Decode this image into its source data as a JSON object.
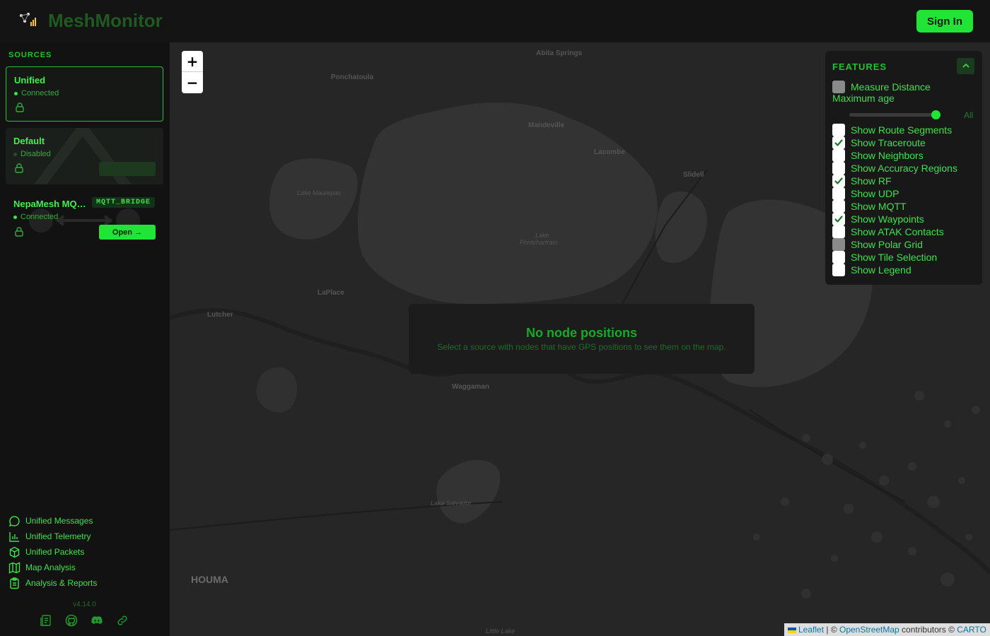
{
  "app": {
    "title": "MeshMonitor",
    "sign_in": "Sign In"
  },
  "sidebar": {
    "sources_title": "SOURCES",
    "sources": [
      {
        "name": "Unified",
        "status": "Connected"
      },
      {
        "name": "Default",
        "status": "Disabled"
      },
      {
        "name": "NepaMesh MQ…",
        "status": "Connected",
        "badge": "MQTT_BRIDGE",
        "action": "Open →"
      }
    ],
    "nav": [
      {
        "label": "Unified Messages",
        "icon": "chat-bubble-icon"
      },
      {
        "label": "Unified Telemetry",
        "icon": "bar-chart-icon"
      },
      {
        "label": "Unified Packets",
        "icon": "package-icon"
      },
      {
        "label": "Map Analysis",
        "icon": "map-icon"
      },
      {
        "label": "Analysis & Reports",
        "icon": "clipboard-icon"
      }
    ],
    "version": "v4.14.0",
    "footer_icons": [
      "docs-icon",
      "github-icon",
      "discord-icon",
      "link-icon"
    ]
  },
  "map": {
    "zoom_in": "+",
    "zoom_out": "−",
    "labels": {
      "abita_springs": "Abita Springs",
      "ponchatoula": "Ponchatoula",
      "mandeville": "Mandeville",
      "lacombe": "Lacombe",
      "slidell": "Slidell",
      "lake_maurepas": "Lake Maurepas",
      "lake_pontchartrain_1": "Lake",
      "lake_pontchartrain_2": "Pontchartrain",
      "laplace": "LaPlace",
      "lutcher": "Lutcher",
      "waggaman": "Waggaman",
      "lake_salvador": "Lake Salvador",
      "houma": "HOUMA",
      "little_lake": "Little Lake"
    },
    "empty_state": {
      "title": "No node positions",
      "subtitle": "Select a source with nodes that have GPS positions to see them on the map."
    },
    "attribution": {
      "leaflet": "Leaflet",
      "sep": " | © ",
      "osm": "OpenStreetMap",
      "contributors": " contributors © ",
      "carto": "CARTO"
    }
  },
  "features": {
    "title": "FEATURES",
    "measure_distance": {
      "label": "Measure Distance",
      "checked": false,
      "disabled": true
    },
    "max_age_label": "Maximum age",
    "max_age_value_label": "All",
    "max_age_fraction": 1.0,
    "options": [
      {
        "label": "Show Route Segments",
        "checked": false,
        "disabled": false
      },
      {
        "label": "Show Traceroute",
        "checked": true,
        "disabled": false
      },
      {
        "label": "Show Neighbors",
        "checked": false,
        "disabled": false
      },
      {
        "label": "Show Accuracy Regions",
        "checked": false,
        "disabled": false
      },
      {
        "label": "Show RF",
        "checked": true,
        "disabled": false
      },
      {
        "label": "Show UDP",
        "checked": false,
        "disabled": false
      },
      {
        "label": "Show MQTT",
        "checked": false,
        "disabled": false
      },
      {
        "label": "Show Waypoints",
        "checked": true,
        "disabled": false
      },
      {
        "label": "Show ATAK Contacts",
        "checked": false,
        "disabled": false
      },
      {
        "label": "Show Polar Grid",
        "checked": false,
        "disabled": true
      },
      {
        "label": "Show Tile Selection",
        "checked": false,
        "disabled": false
      },
      {
        "label": "Show Legend",
        "checked": false,
        "disabled": false
      }
    ]
  },
  "colors": {
    "accent": "#22e436",
    "accent_text": "#3ee04c",
    "background": "#111111",
    "map_land": "#262626",
    "map_water": "#333333"
  }
}
